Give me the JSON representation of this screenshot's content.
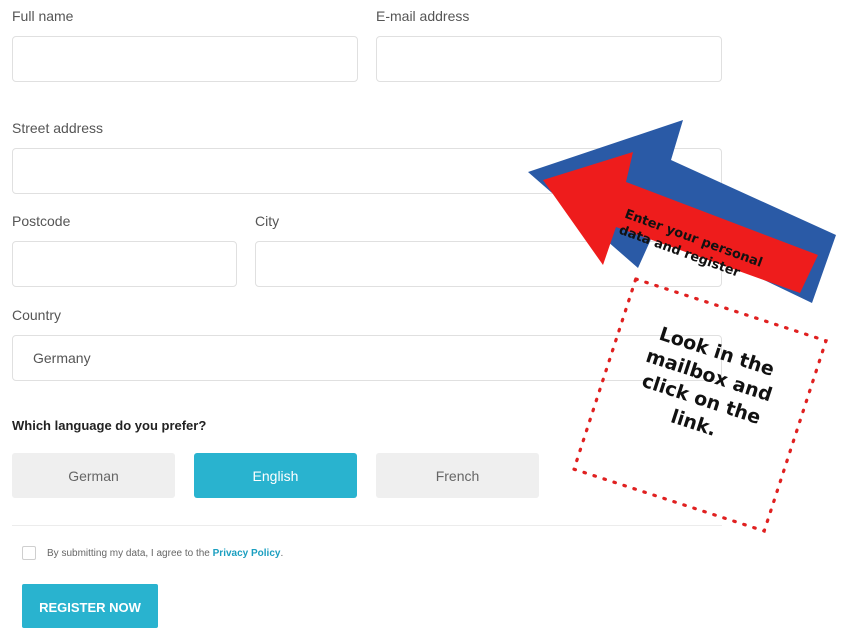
{
  "form": {
    "full_name_label": "Full name",
    "email_label": "E-mail address",
    "street_label": "Street address",
    "postcode_label": "Postcode",
    "city_label": "City",
    "country_label": "Country",
    "country_value": "Germany",
    "language_question": "Which language do you prefer?",
    "languages": [
      "German",
      "English",
      "French"
    ],
    "selected_language": "English",
    "consent_prefix": "By submitting my data, I agree to the ",
    "consent_link": "Privacy Policy",
    "consent_suffix": ".",
    "register_label": "REGISTER NOW"
  },
  "annotations": {
    "arrow_text_line1": "Enter your personal",
    "arrow_text_line2": "data and register",
    "note_line1": "Look in the",
    "note_line2": "mailbox and",
    "note_line3": "click on the",
    "note_line4": "link."
  },
  "colors": {
    "accent": "#29b3cf",
    "arrow_fill": "#ee1c1c",
    "arrow_border": "#2a5aa6",
    "dots": "#e02020"
  }
}
